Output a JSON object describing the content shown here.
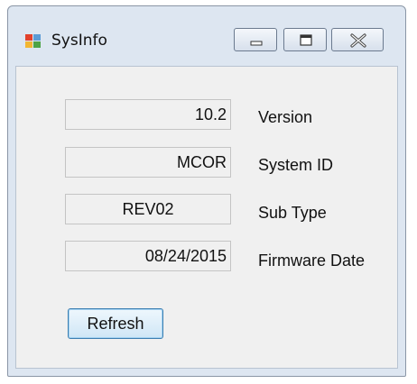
{
  "window": {
    "title": "SysInfo"
  },
  "fields": [
    {
      "value": "10.2",
      "label": "Version"
    },
    {
      "value": "MCOR",
      "label": "System ID"
    },
    {
      "value": "REV02",
      "label": "Sub Type"
    },
    {
      "value": "08/24/2015",
      "label": "Firmware Date"
    }
  ],
  "actions": {
    "refresh_label": "Refresh"
  },
  "icons": {
    "app": "app-window-icon",
    "minimize": "minimize-icon",
    "maximize": "maximize-icon",
    "close": "close-icon"
  },
  "colors": {
    "frame": "#dde6f1",
    "client": "#f0f0f0",
    "button_border": "#3c7fb1"
  }
}
